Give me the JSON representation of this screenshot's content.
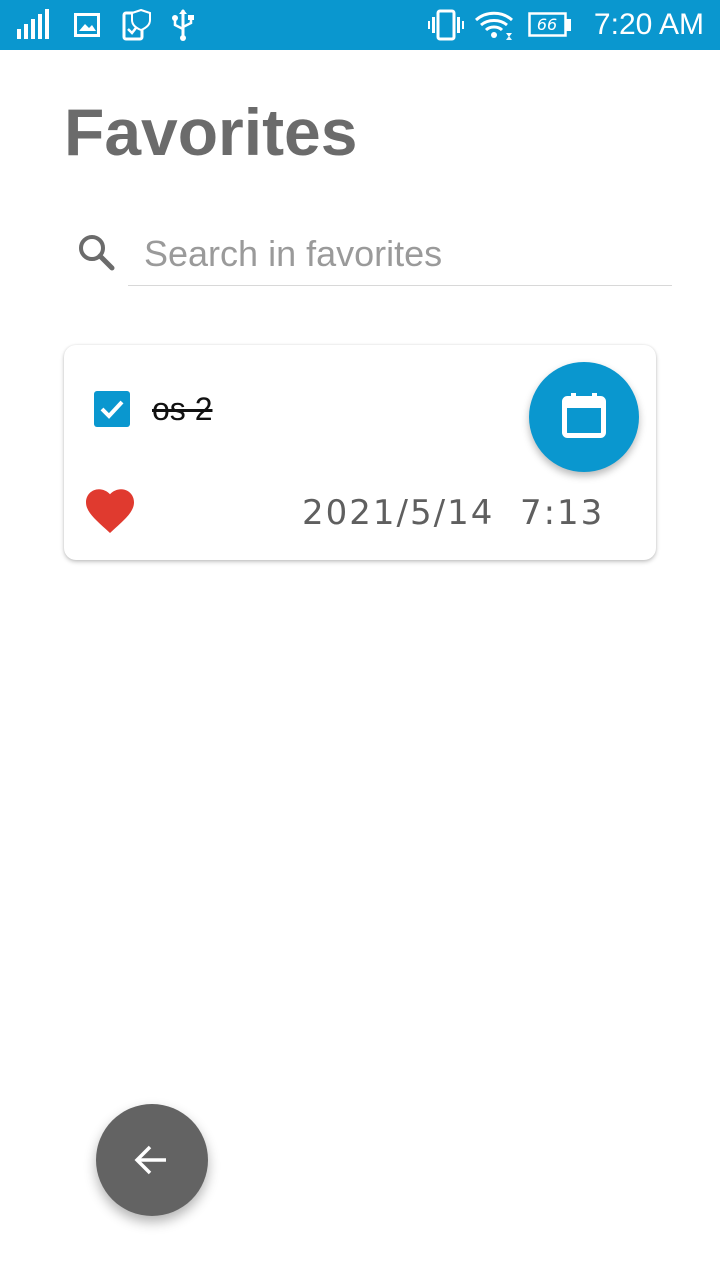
{
  "status_bar": {
    "time": "7:20 AM",
    "battery_level": "66",
    "background_color": "#0a97cf",
    "icons": [
      "signal-icon",
      "image-icon",
      "security-icon",
      "usb-icon",
      "vibrate-icon",
      "wifi-icon",
      "battery-icon"
    ]
  },
  "page": {
    "title": "Favorites"
  },
  "search": {
    "placeholder": "Search in favorites",
    "value": ""
  },
  "favorites": [
    {
      "title": "os 2",
      "checked": true,
      "completed": true,
      "favorite": true,
      "datetime": "2021/5/14  7:13"
    }
  ],
  "colors": {
    "accent": "#0a97cf",
    "heart": "#e03a2f",
    "fab_back": "#636363",
    "title_text": "#6b6b6b"
  }
}
